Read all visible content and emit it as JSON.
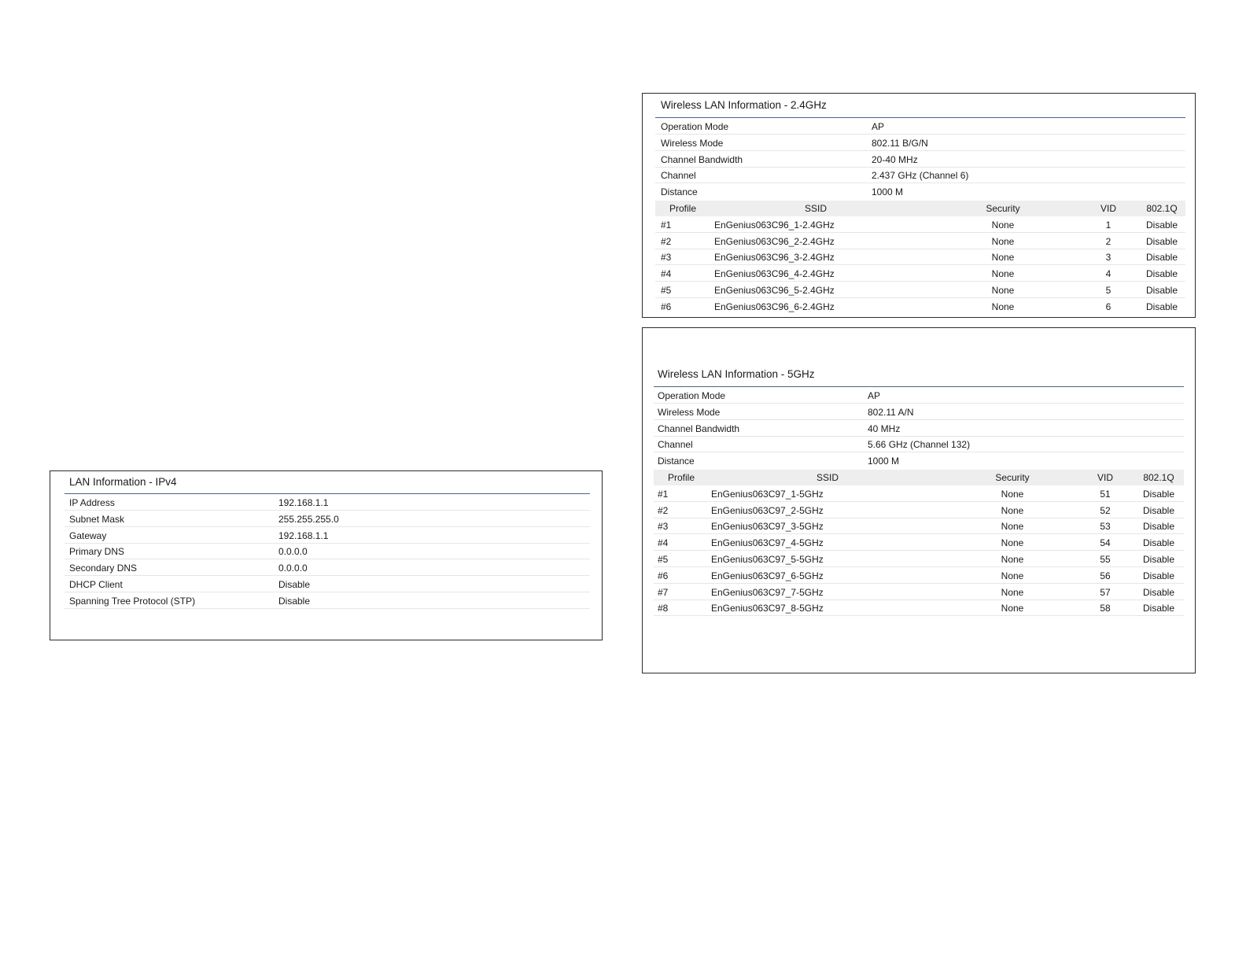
{
  "lan_ipv4": {
    "title": "LAN Information - IPv4",
    "rows": [
      {
        "label": "IP Address",
        "value": "192.168.1.1"
      },
      {
        "label": "Subnet Mask",
        "value": "255.255.255.0"
      },
      {
        "label": "Gateway",
        "value": "192.168.1.1"
      },
      {
        "label": "Primary DNS",
        "value": "0.0.0.0"
      },
      {
        "label": "Secondary DNS",
        "value": "0.0.0.0"
      },
      {
        "label": "DHCP Client",
        "value": "Disable"
      },
      {
        "label": "Spanning Tree Protocol (STP)",
        "value": "Disable"
      }
    ]
  },
  "wlan_24": {
    "title": "Wireless LAN Information - 2.4GHz",
    "rows": [
      {
        "label": "Operation Mode",
        "value": "AP"
      },
      {
        "label": "Wireless Mode",
        "value": "802.11 B/G/N"
      },
      {
        "label": "Channel Bandwidth",
        "value": "20-40 MHz"
      },
      {
        "label": "Channel",
        "value": "2.437 GHz (Channel 6)"
      },
      {
        "label": "Distance",
        "value": "1000 M"
      }
    ],
    "headers": {
      "profile": "Profile",
      "ssid": "SSID",
      "security": "Security",
      "vid": "VID",
      "dot1q": "802.1Q"
    },
    "profiles": [
      {
        "profile": "#1",
        "ssid": "EnGenius063C96_1-2.4GHz",
        "security": "None",
        "vid": "1",
        "dot1q": "Disable"
      },
      {
        "profile": "#2",
        "ssid": "EnGenius063C96_2-2.4GHz",
        "security": "None",
        "vid": "2",
        "dot1q": "Disable"
      },
      {
        "profile": "#3",
        "ssid": "EnGenius063C96_3-2.4GHz",
        "security": "None",
        "vid": "3",
        "dot1q": "Disable"
      },
      {
        "profile": "#4",
        "ssid": "EnGenius063C96_4-2.4GHz",
        "security": "None",
        "vid": "4",
        "dot1q": "Disable"
      },
      {
        "profile": "#5",
        "ssid": "EnGenius063C96_5-2.4GHz",
        "security": "None",
        "vid": "5",
        "dot1q": "Disable"
      },
      {
        "profile": "#6",
        "ssid": "EnGenius063C96_6-2.4GHz",
        "security": "None",
        "vid": "6",
        "dot1q": "Disable"
      }
    ]
  },
  "wlan_5": {
    "title": "Wireless LAN Information - 5GHz",
    "rows": [
      {
        "label": "Operation Mode",
        "value": "AP"
      },
      {
        "label": "Wireless Mode",
        "value": "802.11 A/N"
      },
      {
        "label": "Channel Bandwidth",
        "value": "40 MHz"
      },
      {
        "label": "Channel",
        "value": "5.66 GHz (Channel 132)"
      },
      {
        "label": "Distance",
        "value": "1000 M"
      }
    ],
    "headers": {
      "profile": "Profile",
      "ssid": "SSID",
      "security": "Security",
      "vid": "VID",
      "dot1q": "802.1Q"
    },
    "profiles": [
      {
        "profile": "#1",
        "ssid": "EnGenius063C97_1-5GHz",
        "security": "None",
        "vid": "51",
        "dot1q": "Disable"
      },
      {
        "profile": "#2",
        "ssid": "EnGenius063C97_2-5GHz",
        "security": "None",
        "vid": "52",
        "dot1q": "Disable"
      },
      {
        "profile": "#3",
        "ssid": "EnGenius063C97_3-5GHz",
        "security": "None",
        "vid": "53",
        "dot1q": "Disable"
      },
      {
        "profile": "#4",
        "ssid": "EnGenius063C97_4-5GHz",
        "security": "None",
        "vid": "54",
        "dot1q": "Disable"
      },
      {
        "profile": "#5",
        "ssid": "EnGenius063C97_5-5GHz",
        "security": "None",
        "vid": "55",
        "dot1q": "Disable"
      },
      {
        "profile": "#6",
        "ssid": "EnGenius063C97_6-5GHz",
        "security": "None",
        "vid": "56",
        "dot1q": "Disable"
      },
      {
        "profile": "#7",
        "ssid": "EnGenius063C97_7-5GHz",
        "security": "None",
        "vid": "57",
        "dot1q": "Disable"
      },
      {
        "profile": "#8",
        "ssid": "EnGenius063C97_8-5GHz",
        "security": "None",
        "vid": "58",
        "dot1q": "Disable"
      }
    ]
  }
}
